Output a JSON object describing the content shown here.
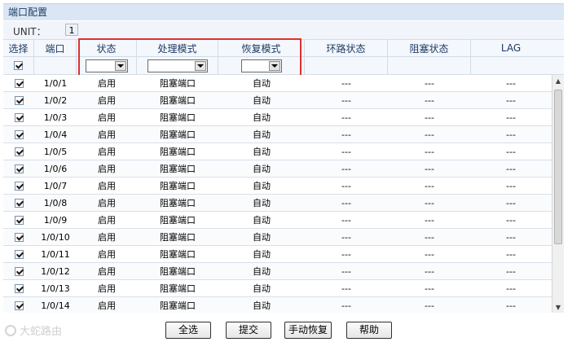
{
  "panel": {
    "title": "端口配置"
  },
  "unit": {
    "label": "UNIT：",
    "value": "1"
  },
  "columns": [
    "选择",
    "端口",
    "状态",
    "处理模式",
    "恢复模式",
    "环路状态",
    "阻塞状态",
    "LAG"
  ],
  "rows": [
    {
      "port": "1/0/1",
      "status": "启用",
      "mode": "阻塞端口",
      "recover": "自动",
      "loop": "---",
      "block": "---",
      "lag": "---"
    },
    {
      "port": "1/0/2",
      "status": "启用",
      "mode": "阻塞端口",
      "recover": "自动",
      "loop": "---",
      "block": "---",
      "lag": "---"
    },
    {
      "port": "1/0/3",
      "status": "启用",
      "mode": "阻塞端口",
      "recover": "自动",
      "loop": "---",
      "block": "---",
      "lag": "---"
    },
    {
      "port": "1/0/4",
      "status": "启用",
      "mode": "阻塞端口",
      "recover": "自动",
      "loop": "---",
      "block": "---",
      "lag": "---"
    },
    {
      "port": "1/0/5",
      "status": "启用",
      "mode": "阻塞端口",
      "recover": "自动",
      "loop": "---",
      "block": "---",
      "lag": "---"
    },
    {
      "port": "1/0/6",
      "status": "启用",
      "mode": "阻塞端口",
      "recover": "自动",
      "loop": "---",
      "block": "---",
      "lag": "---"
    },
    {
      "port": "1/0/7",
      "status": "启用",
      "mode": "阻塞端口",
      "recover": "自动",
      "loop": "---",
      "block": "---",
      "lag": "---"
    },
    {
      "port": "1/0/8",
      "status": "启用",
      "mode": "阻塞端口",
      "recover": "自动",
      "loop": "---",
      "block": "---",
      "lag": "---"
    },
    {
      "port": "1/0/9",
      "status": "启用",
      "mode": "阻塞端口",
      "recover": "自动",
      "loop": "---",
      "block": "---",
      "lag": "---"
    },
    {
      "port": "1/0/10",
      "status": "启用",
      "mode": "阻塞端口",
      "recover": "自动",
      "loop": "---",
      "block": "---",
      "lag": "---"
    },
    {
      "port": "1/0/11",
      "status": "启用",
      "mode": "阻塞端口",
      "recover": "自动",
      "loop": "---",
      "block": "---",
      "lag": "---"
    },
    {
      "port": "1/0/12",
      "status": "启用",
      "mode": "阻塞端口",
      "recover": "自动",
      "loop": "---",
      "block": "---",
      "lag": "---"
    },
    {
      "port": "1/0/13",
      "status": "启用",
      "mode": "阻塞端口",
      "recover": "自动",
      "loop": "---",
      "block": "---",
      "lag": "---"
    },
    {
      "port": "1/0/14",
      "status": "启用",
      "mode": "阻塞端口",
      "recover": "自动",
      "loop": "---",
      "block": "---",
      "lag": "---"
    }
  ],
  "buttons": {
    "select_all": "全选",
    "submit": "提交",
    "manual_recover": "手动恢复",
    "help": "帮助"
  },
  "watermark": "大蛇路由",
  "colors": {
    "highlight": "#e03030",
    "panel_bg": "#dbe6f4"
  }
}
